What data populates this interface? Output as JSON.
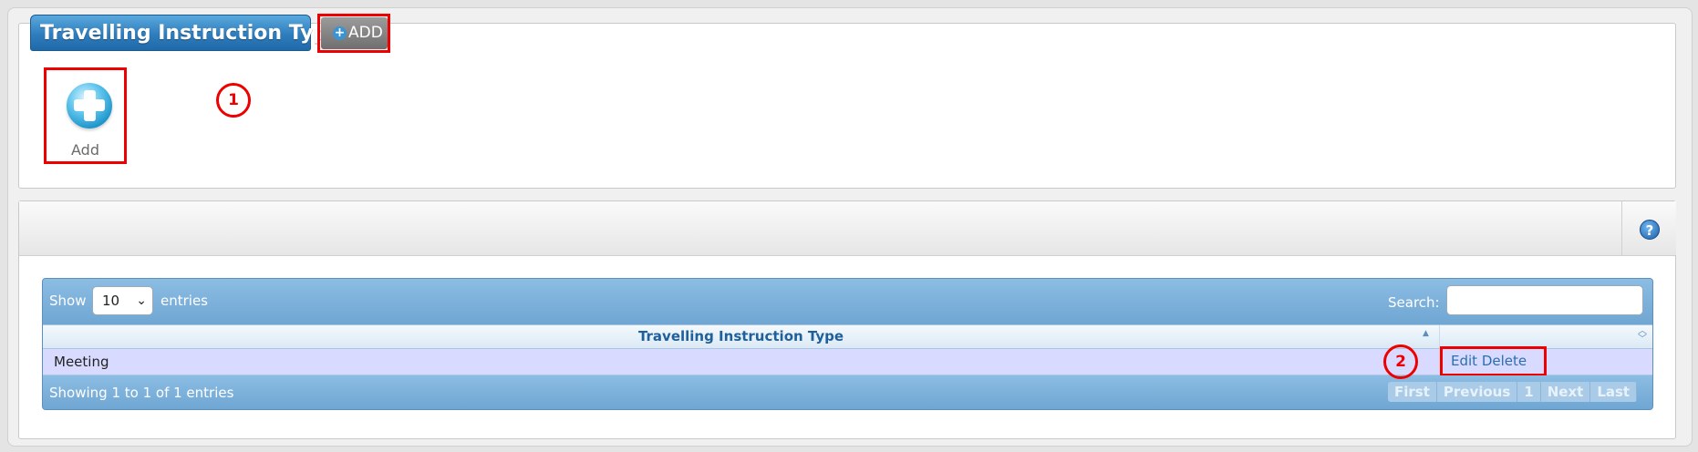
{
  "header": {
    "title": "Travelling Instruction Types",
    "add_button_label": "ADD"
  },
  "quick_actions": {
    "add_label": "Add"
  },
  "annotations": {
    "badge_1": "1",
    "badge_2": "2"
  },
  "help": {
    "icon": "?"
  },
  "table": {
    "show_label": "Show",
    "page_size": "10",
    "entries_label": "entries",
    "search_label": "Search:",
    "search_value": "",
    "columns": [
      "Travelling Instruction Type",
      ""
    ],
    "rows": [
      {
        "type": "Meeting",
        "edit_label": "Edit",
        "delete_label": "Delete"
      }
    ],
    "info": "Showing 1 to 1 of 1 entries",
    "pagination": {
      "first": "First",
      "previous": "Previous",
      "page": "1",
      "next": "Next",
      "last": "Last"
    }
  },
  "colors": {
    "title_blue": "#2f7dbd",
    "table_blue": "#7fb2da",
    "highlight_red": "#ee0000",
    "row_bg": "#d8dbff"
  }
}
